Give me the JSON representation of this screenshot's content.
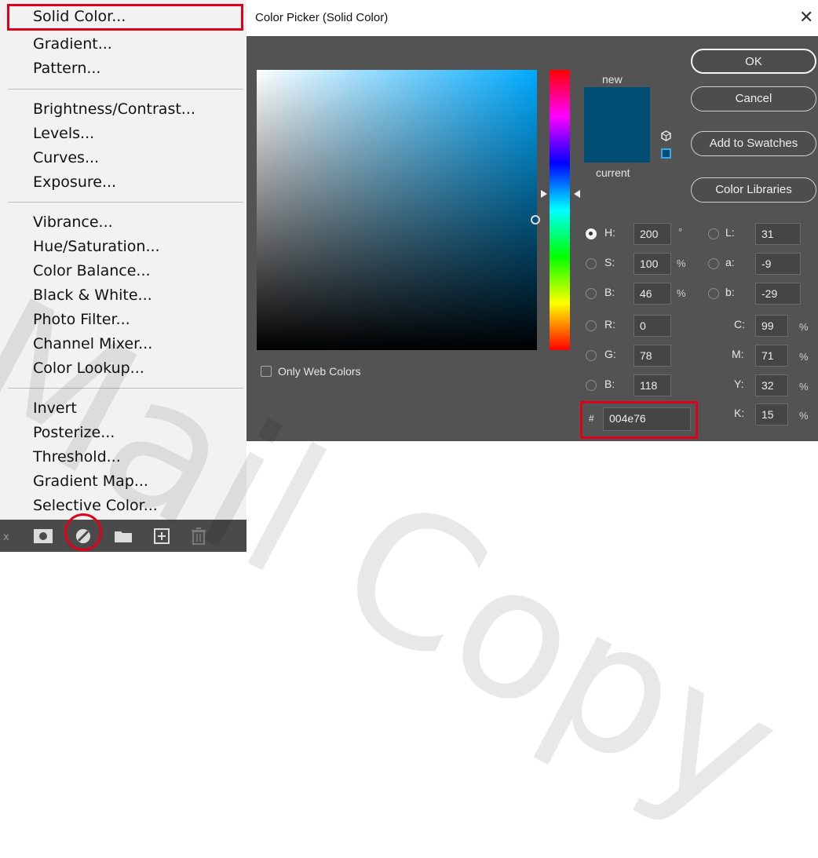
{
  "menu": {
    "groups": [
      [
        "Solid Color...",
        "Gradient...",
        "Pattern..."
      ],
      [
        "Brightness/Contrast...",
        "Levels...",
        "Curves...",
        "Exposure..."
      ],
      [
        "Vibrance...",
        "Hue/Saturation...",
        "Color Balance...",
        "Black & White...",
        "Photo Filter...",
        "Channel Mixer...",
        "Color Lookup..."
      ],
      [
        "Invert",
        "Posterize...",
        "Threshold...",
        "Gradient Map...",
        "Selective Color..."
      ]
    ],
    "highlighted": "Solid Color..."
  },
  "toolbar": {
    "icons": [
      "link-layers-icon",
      "add-mask-icon",
      "adjustment-layer-icon",
      "new-group-icon",
      "new-layer-icon",
      "delete-layer-icon"
    ]
  },
  "dialog": {
    "title": "Color Picker (Solid Color)",
    "close": "✕",
    "new_label": "new",
    "current_label": "current",
    "only_web_colors": "Only Web Colors",
    "buttons": {
      "ok": "OK",
      "cancel": "Cancel",
      "add_to_swatches": "Add to Swatches",
      "color_libraries": "Color Libraries"
    },
    "hsb": {
      "h": {
        "label": "H:",
        "value": "200",
        "unit": "°"
      },
      "s": {
        "label": "S:",
        "value": "100",
        "unit": "%"
      },
      "b": {
        "label": "B:",
        "value": "46",
        "unit": "%"
      }
    },
    "rgb": {
      "r": {
        "label": "R:",
        "value": "0"
      },
      "g": {
        "label": "G:",
        "value": "78"
      },
      "b": {
        "label": "B:",
        "value": "118"
      }
    },
    "lab": {
      "l": {
        "label": "L:",
        "value": "31"
      },
      "a": {
        "label": "a:",
        "value": "-9"
      },
      "b": {
        "label": "b:",
        "value": "-29"
      }
    },
    "cmyk": {
      "c": {
        "label": "C:",
        "value": "99",
        "unit": "%"
      },
      "m": {
        "label": "M:",
        "value": "71",
        "unit": "%"
      },
      "y": {
        "label": "Y:",
        "value": "32",
        "unit": "%"
      },
      "k": {
        "label": "K:",
        "value": "15",
        "unit": "%"
      }
    },
    "hex": {
      "label": "#",
      "value": "004e76"
    },
    "selected_mode": "H",
    "color": "#004e76"
  },
  "colors": {
    "highlight": "#e0001b",
    "dialog_bg": "#535353",
    "menu_bg": "#f2f2f2"
  },
  "watermark": "Mail Copy"
}
